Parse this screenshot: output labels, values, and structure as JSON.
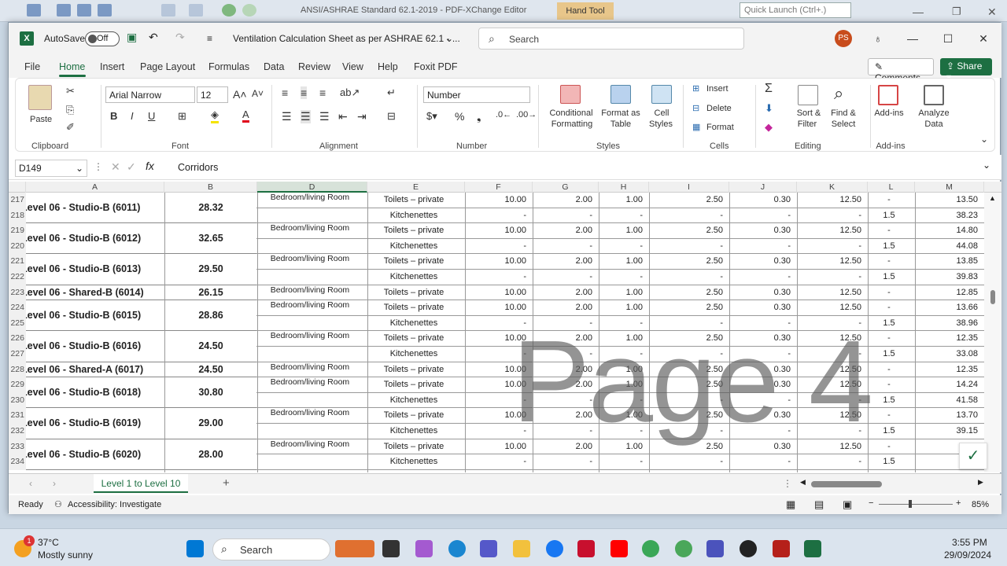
{
  "bg_app": {
    "title": "ANSI/ASHRAE Standard 62.1-2019 - PDF-XChange Editor",
    "hand_tool": "Hand Tool",
    "quick_launch": "Quick Launch (Ctrl+.)"
  },
  "excel": {
    "autosave": "AutoSave",
    "autosave_state": "Off",
    "doc_title": "Ventilation Calculation Sheet as per ASHRAE 62.1 -  ...",
    "search": "Search",
    "avatar": "PS",
    "tabs": [
      "File",
      "Home",
      "Insert",
      "Page Layout",
      "Formulas",
      "Data",
      "Review",
      "View",
      "Help",
      "Foxit PDF"
    ],
    "comments": "Comments",
    "share": "Share",
    "ribbon": {
      "groups": [
        "Clipboard",
        "Font",
        "Alignment",
        "Number",
        "Styles",
        "Cells",
        "Editing",
        "Add-ins"
      ],
      "paste": "Paste",
      "font_name": "Arial Narrow",
      "font_size": "12",
      "number_format": "Number",
      "conditional": "Conditional",
      "formatting": "Formatting",
      "format_as": "Format as",
      "table": "Table",
      "cell": "Cell",
      "styles": "Styles",
      "insert": "Insert",
      "delete": "Delete",
      "format": "Format",
      "sort": "Sort &",
      "filter": "Filter",
      "find": "Find &",
      "select": "Select",
      "addins": "Add-ins",
      "analyze": "Analyze",
      "data": "Data"
    },
    "name_box": "D149",
    "formula": "Corridors",
    "columns": [
      "A",
      "B",
      "D",
      "E",
      "F",
      "G",
      "H",
      "I",
      "J",
      "K",
      "L",
      "M"
    ],
    "rows": [
      {
        "n": "217",
        "d": "Bedroom/living Room",
        "e": "Toilets – private",
        "f": "10.00",
        "g": "2.00",
        "h": "1.00",
        "i": "2.50",
        "j": "0.30",
        "k": "12.50",
        "l": "-",
        "m": "13.50"
      },
      {
        "n": "218",
        "d": "",
        "e": "Kitchenettes",
        "f": "-",
        "g": "-",
        "h": "-",
        "i": "-",
        "j": "-",
        "k": "-",
        "l": "1.5",
        "m": "38.23"
      },
      {
        "n": "219",
        "d": "Bedroom/living Room",
        "e": "Toilets – private",
        "f": "10.00",
        "g": "2.00",
        "h": "1.00",
        "i": "2.50",
        "j": "0.30",
        "k": "12.50",
        "l": "-",
        "m": "14.80"
      },
      {
        "n": "220",
        "d": "",
        "e": "Kitchenettes",
        "f": "-",
        "g": "-",
        "h": "-",
        "i": "-",
        "j": "-",
        "k": "-",
        "l": "1.5",
        "m": "44.08"
      },
      {
        "n": "221",
        "d": "Bedroom/living Room",
        "e": "Toilets – private",
        "f": "10.00",
        "g": "2.00",
        "h": "1.00",
        "i": "2.50",
        "j": "0.30",
        "k": "12.50",
        "l": "-",
        "m": "13.85"
      },
      {
        "n": "222",
        "d": "",
        "e": "Kitchenettes",
        "f": "-",
        "g": "-",
        "h": "-",
        "i": "-",
        "j": "-",
        "k": "-",
        "l": "1.5",
        "m": "39.83"
      },
      {
        "n": "223",
        "d": "Bedroom/living Room",
        "e": "Toilets – private",
        "f": "10.00",
        "g": "2.00",
        "h": "1.00",
        "i": "2.50",
        "j": "0.30",
        "k": "12.50",
        "l": "-",
        "m": "12.85"
      },
      {
        "n": "224",
        "d": "Bedroom/living Room",
        "e": "Toilets – private",
        "f": "10.00",
        "g": "2.00",
        "h": "1.00",
        "i": "2.50",
        "j": "0.30",
        "k": "12.50",
        "l": "-",
        "m": "13.66"
      },
      {
        "n": "225",
        "d": "",
        "e": "Kitchenettes",
        "f": "-",
        "g": "-",
        "h": "-",
        "i": "-",
        "j": "-",
        "k": "-",
        "l": "1.5",
        "m": "38.96"
      },
      {
        "n": "226",
        "d": "Bedroom/living Room",
        "e": "Toilets – private",
        "f": "10.00",
        "g": "2.00",
        "h": "1.00",
        "i": "2.50",
        "j": "0.30",
        "k": "12.50",
        "l": "-",
        "m": "12.35"
      },
      {
        "n": "227",
        "d": "",
        "e": "Kitchenettes",
        "f": "-",
        "g": "-",
        "h": "-",
        "i": "-",
        "j": "-",
        "k": "-",
        "l": "1.5",
        "m": "33.08"
      },
      {
        "n": "228",
        "d": "Bedroom/living Room",
        "e": "Toilets – private",
        "f": "10.00",
        "g": "2.00",
        "h": "1.00",
        "i": "2.50",
        "j": "0.30",
        "k": "12.50",
        "l": "-",
        "m": "12.35"
      },
      {
        "n": "229",
        "d": "Bedroom/living Room",
        "e": "Toilets – private",
        "f": "10.00",
        "g": "2.00",
        "h": "1.00",
        "i": "2.50",
        "j": "0.30",
        "k": "12.50",
        "l": "-",
        "m": "14.24"
      },
      {
        "n": "230",
        "d": "",
        "e": "Kitchenettes",
        "f": "-",
        "g": "-",
        "h": "-",
        "i": "-",
        "j": "-",
        "k": "-",
        "l": "1.5",
        "m": "41.58"
      },
      {
        "n": "231",
        "d": "Bedroom/living Room",
        "e": "Toilets – private",
        "f": "10.00",
        "g": "2.00",
        "h": "1.00",
        "i": "2.50",
        "j": "0.30",
        "k": "12.50",
        "l": "-",
        "m": "13.70"
      },
      {
        "n": "232",
        "d": "",
        "e": "Kitchenettes",
        "f": "-",
        "g": "-",
        "h": "-",
        "i": "-",
        "j": "-",
        "k": "-",
        "l": "1.5",
        "m": "39.15"
      },
      {
        "n": "233",
        "d": "Bedroom/living Room",
        "e": "Toilets – private",
        "f": "10.00",
        "g": "2.00",
        "h": "1.00",
        "i": "2.50",
        "j": "0.30",
        "k": "12.50",
        "l": "-",
        "m": ""
      },
      {
        "n": "234",
        "d": "",
        "e": "Kitchenettes",
        "f": "-",
        "g": "-",
        "h": "-",
        "i": "-",
        "j": "-",
        "k": "-",
        "l": "1.5",
        "m": ""
      }
    ],
    "units": [
      {
        "name": "Level 06 - Studio-B (6011)",
        "area": "28.32",
        "start": 0,
        "span": 2
      },
      {
        "name": "Level 06 - Studio-B (6012)",
        "area": "32.65",
        "start": 2,
        "span": 2
      },
      {
        "name": "Level 06 - Studio-B (6013)",
        "area": "29.50",
        "start": 4,
        "span": 2
      },
      {
        "name": "Level 06 - Shared-B (6014)",
        "area": "26.15",
        "start": 6,
        "span": 1
      },
      {
        "name": "Level 06 - Studio-B (6015)",
        "area": "28.86",
        "start": 7,
        "span": 2
      },
      {
        "name": "Level 06 - Studio-B (6016)",
        "area": "24.50",
        "start": 9,
        "span": 2
      },
      {
        "name": "Level 06 - Shared-A (6017)",
        "area": "24.50",
        "start": 11,
        "span": 1
      },
      {
        "name": "Level 06 - Studio-B (6018)",
        "area": "30.80",
        "start": 12,
        "span": 2
      },
      {
        "name": "Level 06 - Studio-B (6019)",
        "area": "29.00",
        "start": 14,
        "span": 2
      },
      {
        "name": "Level 06 - Studio-B (6020)",
        "area": "28.00",
        "start": 16,
        "span": 2
      }
    ],
    "watermark": "Page 4",
    "sheet_tab": "Level 1 to Level 10",
    "status": {
      "ready": "Ready",
      "accessibility": "Accessibility: Investigate",
      "zoom": "85%"
    }
  },
  "taskbar": {
    "weather_temp": "37°C",
    "weather_desc": "Mostly sunny",
    "search": "Search",
    "time": "3:55 PM",
    "date": "29/09/2024",
    "badge": "1"
  }
}
